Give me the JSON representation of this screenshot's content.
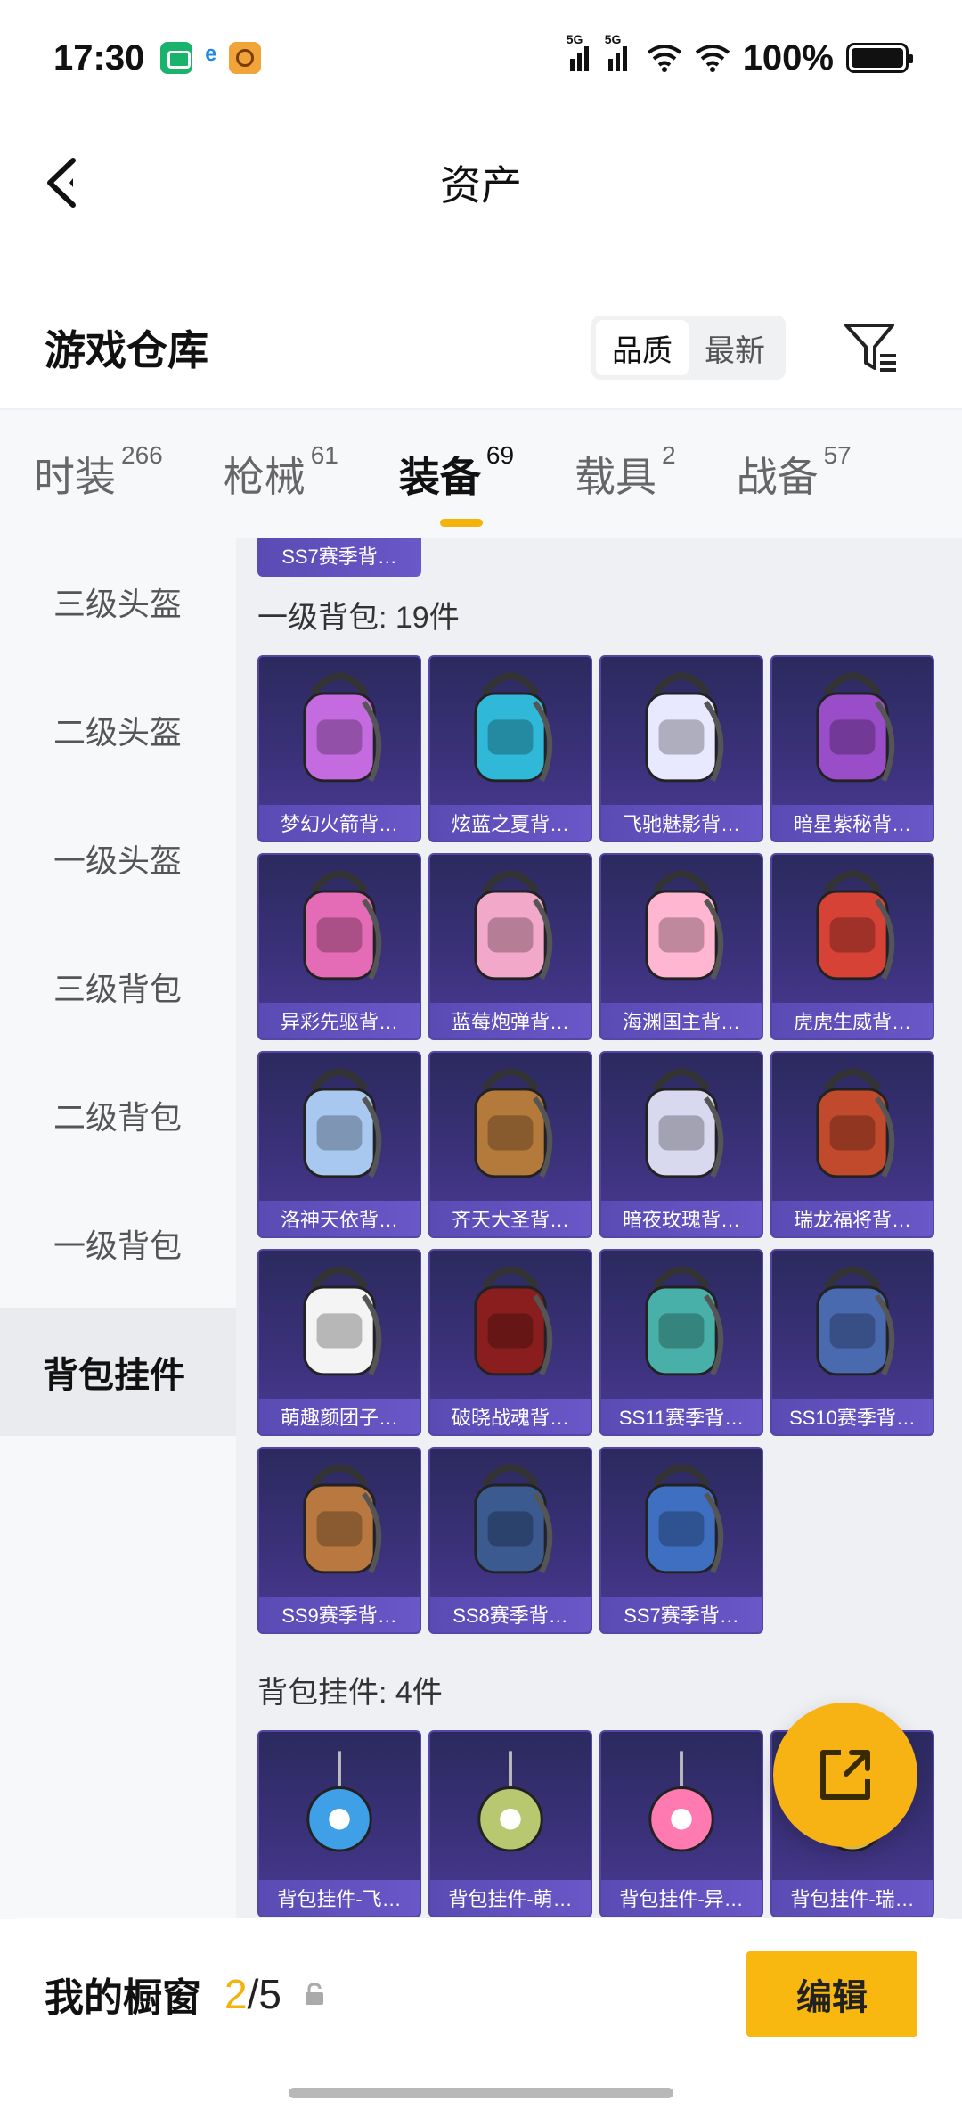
{
  "status_bar": {
    "time": "17:30",
    "signal1_tag": "5G",
    "signal2_tag": "5G",
    "battery_text": "100%",
    "icons": [
      "app-green-icon",
      "telecom-icon",
      "app-orange-icon",
      "wifi-icon",
      "battery-icon"
    ]
  },
  "nav": {
    "title": "资产",
    "back_icon": "chevron-left-icon"
  },
  "section": {
    "title": "游戏仓库",
    "sort_options": [
      "品质",
      "最新"
    ],
    "sort_selected": "品质",
    "filter_icon": "filter-icon"
  },
  "tabs": [
    {
      "label": "时装",
      "count": "266"
    },
    {
      "label": "枪械",
      "count": "61"
    },
    {
      "label": "装备",
      "count": "69",
      "active": true
    },
    {
      "label": "载具",
      "count": "2"
    },
    {
      "label": "战备",
      "count": "57"
    }
  ],
  "sidebar": {
    "items": [
      "三级头盔",
      "二级头盔",
      "一级头盔",
      "三级背包",
      "二级背包",
      "一级背包",
      "背包挂件"
    ],
    "active": "背包挂件"
  },
  "grid": {
    "partial_top_item": "SS7赛季背…",
    "groups": [
      {
        "label": "一级背包: 19件",
        "items": [
          "梦幻火箭背…",
          "炫蓝之夏背…",
          "飞驰魅影背…",
          "暗星紫秘背…",
          "异彩先驱背…",
          "蓝莓炮弹背…",
          "海渊国主背…",
          "虎虎生威背…",
          "洛神天依背…",
          "齐天大圣背…",
          "暗夜玫瑰背…",
          "瑞龙福将背…",
          "萌趣颜团子…",
          "破晓战魂背…",
          "SS11赛季背…",
          "SS10赛季背…",
          "SS9赛季背…",
          "SS8赛季背…",
          "SS7赛季背…"
        ]
      },
      {
        "label": "背包挂件: 4件",
        "items": [
          "背包挂件-飞…",
          "背包挂件-萌…",
          "背包挂件-异…",
          "背包挂件-瑞…"
        ]
      }
    ]
  },
  "fab": {
    "icon": "share-external-icon"
  },
  "bottom": {
    "label": "我的橱窗",
    "count_current": "2",
    "count_separator": "/5",
    "lock_icon": "lock-icon",
    "edit_label": "编辑"
  },
  "colors": {
    "accent": "#f5b20b",
    "card_bg": "#3b317a",
    "card_label": "#6a57c8"
  }
}
